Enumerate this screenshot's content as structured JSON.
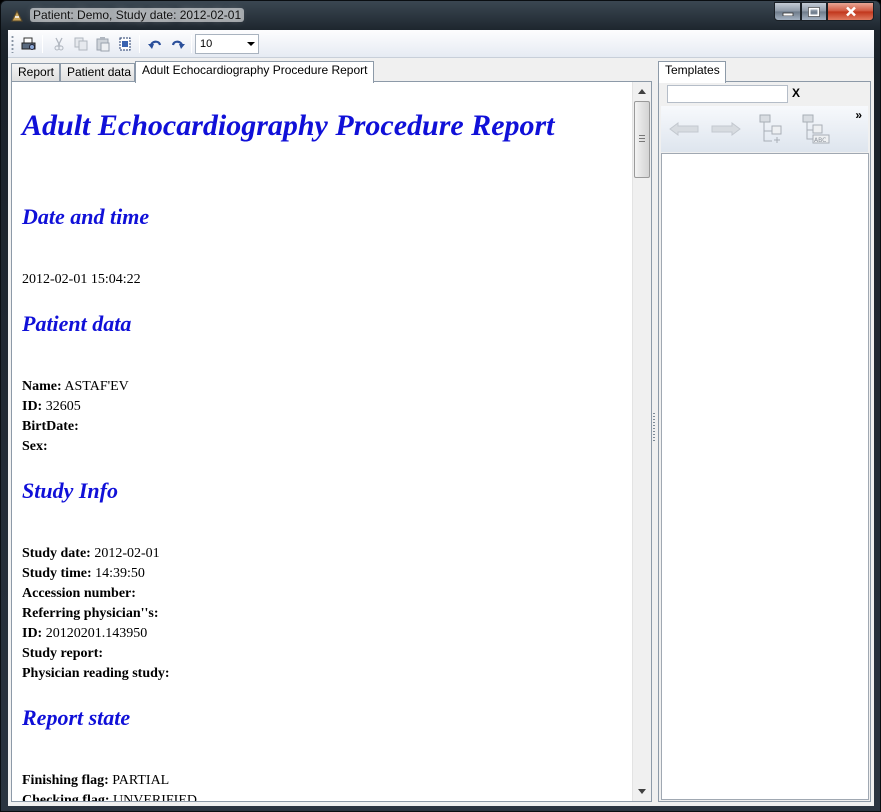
{
  "window": {
    "title": "Patient: Demo, Study date: 2012-02-01"
  },
  "toolbar": {
    "zoom_value": "10"
  },
  "tabs": [
    {
      "label": "Report"
    },
    {
      "label": "Patient data"
    },
    {
      "label": "Adult Echocardiography Procedure Report"
    }
  ],
  "right_tabs": [
    {
      "label": "Templates"
    }
  ],
  "right_panel": {
    "search_value": "",
    "clear_label": "X",
    "overflow_label": "»"
  },
  "report": {
    "title": "Adult Echocardiography Procedure Report",
    "sections": {
      "date_time": {
        "heading": "Date and time",
        "value": "2012-02-01 15:04:22"
      },
      "patient": {
        "heading": "Patient data",
        "name_label": "Name:",
        "name_value": " ASTAF'EV",
        "id_label": "ID:",
        "id_value": " 32605",
        "birth_label": "BirtDate:",
        "birth_value": "",
        "sex_label": "Sex:",
        "sex_value": ""
      },
      "study": {
        "heading": "Study Info",
        "date_label": "Study date:",
        "date_value": " 2012-02-01",
        "time_label": "Study time:",
        "time_value": " 14:39:50",
        "accession_label": "Accession number:",
        "accession_value": "",
        "referring_label": "Referring physician''s:",
        "referring_value": "",
        "id_label": "ID:",
        "id_value": " 20120201.143950",
        "report_label": "Study report:",
        "report_value": "",
        "reading_label": "Physician reading study:",
        "reading_value": ""
      },
      "state": {
        "heading": "Report state",
        "finishing_label": "Finishing flag:",
        "finishing_value": " PARTIAL",
        "checking_label": "Checking flag:",
        "checking_value": " UNVERIFIED"
      }
    }
  },
  "colors": {
    "heading": "#1010d8",
    "close_button": "#c0341a"
  }
}
